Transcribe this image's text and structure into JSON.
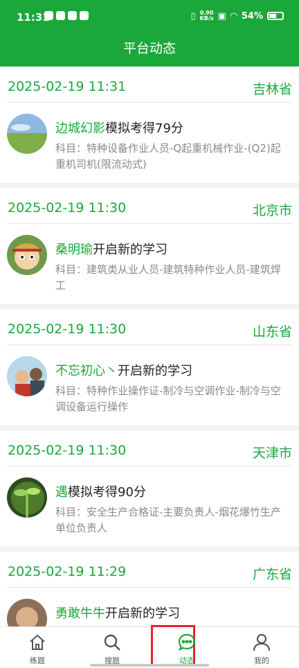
{
  "status_bar": {
    "time": "11:31",
    "net_speed_top": "0.90",
    "net_speed_unit": "KB/s",
    "battery": "54%"
  },
  "header": {
    "title": "平台动态"
  },
  "feed": [
    {
      "time": "2025-02-19 11:31",
      "place": "吉林省",
      "user": "边城幻影",
      "action": "模拟考得79分",
      "subject": "科目：特种设备作业人员-Q起重机械作业-(Q2)起重机司机(限流动式)"
    },
    {
      "time": "2025-02-19 11:30",
      "place": "北京市",
      "user": "桑明瑜",
      "action": "开启新的学习",
      "subject": "科目：建筑类从业人员-建筑特种作业人员-建筑焊工"
    },
    {
      "time": "2025-02-19 11:30",
      "place": "山东省",
      "user": "不忘初心丶",
      "action": "开启新的学习",
      "subject": "科目：特种作业操作证-制冷与空调作业-制冷与空调设备运行操作"
    },
    {
      "time": "2025-02-19 11:30",
      "place": "天津市",
      "user": "遇",
      "action": "模拟考得90分",
      "subject": "科目：安全生产合格证-主要负责人-烟花爆竹生产单位负责人"
    },
    {
      "time": "2025-02-19 11:29",
      "place": "广东省",
      "user": "勇敢牛牛",
      "action": "开启新的学习",
      "subject": ""
    }
  ],
  "tabbar": {
    "tabs": [
      {
        "label": "练题",
        "icon": "home-icon"
      },
      {
        "label": "搜题",
        "icon": "search-icon"
      },
      {
        "label": "动态",
        "icon": "chat-bubble-icon"
      },
      {
        "label": "我的",
        "icon": "user-icon"
      }
    ],
    "active": "动态"
  },
  "colors": {
    "brand_green": "#1aa83a",
    "highlight_red": "#e8212b"
  }
}
